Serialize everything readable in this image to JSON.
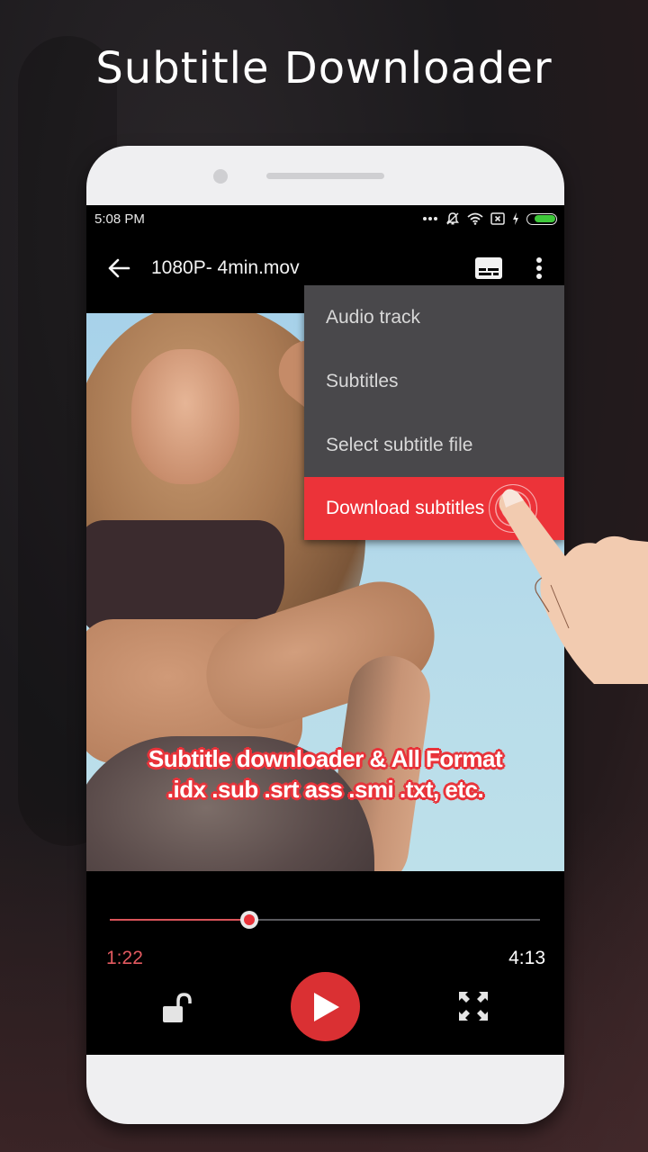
{
  "promo": {
    "headline": "Subtitle Downloader"
  },
  "status_bar": {
    "time": "5:08 PM",
    "icons": [
      "more-dots-icon",
      "notifications-off-icon",
      "wifi-icon",
      "sim-x-icon",
      "charging-bolt-icon",
      "battery-icon"
    ],
    "battery_color": "#3ec83a"
  },
  "toolbar": {
    "back_icon": "arrow-left-icon",
    "title": "1080P- 4min.mov",
    "subtitle_icon": "subtitles-icon",
    "overflow_icon": "more-vert-icon"
  },
  "menu": {
    "items": [
      {
        "label": "Audio track",
        "active": false
      },
      {
        "label": "Subtitles",
        "active": false
      },
      {
        "label": "Select subtitle file",
        "active": false
      },
      {
        "label": "Download subtitles",
        "active": true
      }
    ],
    "active_color": "#ec3339",
    "background_color": "#49484b"
  },
  "video": {
    "caption_lines": [
      "Subtitle downloader & All Format",
      ".idx .sub .srt ass .smi .txt, etc."
    ],
    "caption_outline_color": "#e8333a"
  },
  "player": {
    "current_time": "1:22",
    "total_time": "4:13",
    "progress_fraction": 0.324,
    "accent_color": "#da3033",
    "lock_icon": "lock-open-icon",
    "play_icon": "play-icon",
    "fullscreen_icon": "fullscreen-icon"
  }
}
